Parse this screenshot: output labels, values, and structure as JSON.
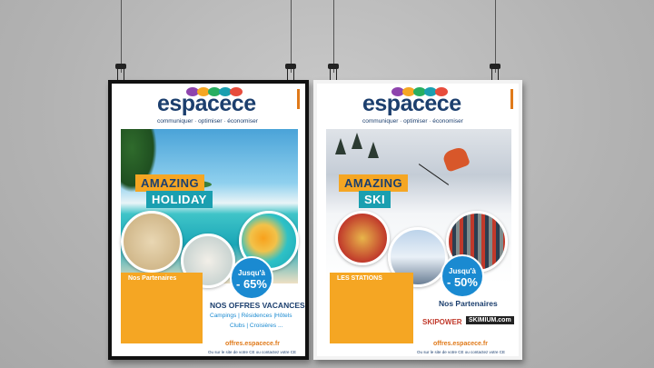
{
  "left_poster": {
    "logo_main": "espace",
    "logo_ce": "ce",
    "tagline": "communiquer · optimiser · économiser",
    "title_line1": "AMAZING",
    "title_line2": "HOLIDAY",
    "discount_line1": "Jusqu'à",
    "discount_line2": "- 65%",
    "panel_heading": "Nos Partenaires",
    "offers_title": "NOS OFFRES VACANCES",
    "offers_sub1": "Campings | Résidences |Hôtels",
    "offers_sub2": "Clubs | Croisières ...",
    "url": "offres.espacece.fr",
    "footer": "Ou sur le site de votre CE ou contactez votre CE"
  },
  "right_poster": {
    "logo_main": "espace",
    "logo_ce": "ce",
    "tagline": "communiquer · optimiser · économiser",
    "title_line1": "AMAZING",
    "title_line2": "SKI",
    "discount_line1": "Jusqu'à",
    "discount_line2": "- 50%",
    "panel_heading": "LES STATIONS",
    "partners_title": "Nos Partenaires",
    "brand1": "SKIPOWER",
    "brand2": "SKIMIUM.com",
    "url": "offres.espacece.fr",
    "footer": "Ou sur le site de votre CE ou contactez votre CE"
  },
  "colors": {
    "navy": "#1c3f6e",
    "orange": "#f5a623",
    "teal": "#1a9fb0",
    "blue": "#1a8ad1"
  }
}
